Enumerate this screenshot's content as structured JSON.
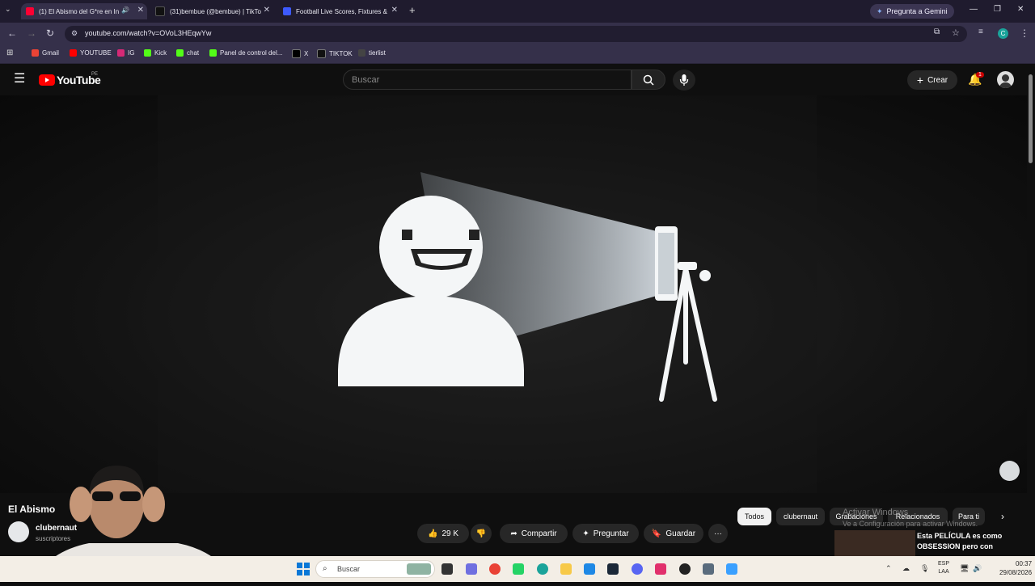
{
  "browser": {
    "tabs": [
      {
        "label": "(1) El Abismo del G*re en In",
        "active": true,
        "favicon_color": "#ff0033"
      },
      {
        "label": "(31)bembue (@bembue) | TikTo",
        "active": false,
        "favicon_color": "#111111"
      },
      {
        "label": "Football Live Scores, Fixtures &",
        "active": false,
        "favicon_color": "#3d5afe"
      }
    ],
    "gemini_label": "Pregunta a Gemini",
    "url": "youtube.com/watch?v=OVoL3HEqwYw",
    "profile_initial": "C",
    "bookmarks": [
      {
        "label": "Gmail",
        "color": "#ea4335"
      },
      {
        "label": "YOUTUBE",
        "color": "#ff0000"
      },
      {
        "label": "IG",
        "color": "#d62976"
      },
      {
        "label": "Kick",
        "color": "#53fc18"
      },
      {
        "label": "chat",
        "color": "#53fc18"
      },
      {
        "label": "Panel de control del...",
        "color": "#53fc18"
      },
      {
        "label": "X",
        "color": "#000000"
      },
      {
        "label": "TIKTOK",
        "color": "#111111"
      },
      {
        "label": "tierlist",
        "color": "#444444"
      }
    ]
  },
  "youtube": {
    "logo_text": "YouTube",
    "region": "PE",
    "search_placeholder": "Buscar",
    "create_label": "Crear",
    "notification_count": "1",
    "video": {
      "title": "El Abismo",
      "channel": "clubernaut",
      "subscribers": "suscriptores",
      "likes": "29 K",
      "share_label": "Compartir",
      "ask_label": "Preguntar",
      "save_label": "Guardar"
    },
    "chips": [
      "Todos",
      "clubernaut",
      "Grabaciones",
      "Relacionados",
      "Para ti"
    ],
    "recommended_title": "Esta PELÍCULA es como OBSESSION pero con"
  },
  "windows": {
    "activate_title": "Activar Windows",
    "activate_sub": "Ve a Configuración para activar Windows.",
    "taskbar_search": "Buscar",
    "lang_top": "ESP",
    "lang_bottom": "LAA",
    "time": "00:37",
    "date": "29/08/2026"
  }
}
